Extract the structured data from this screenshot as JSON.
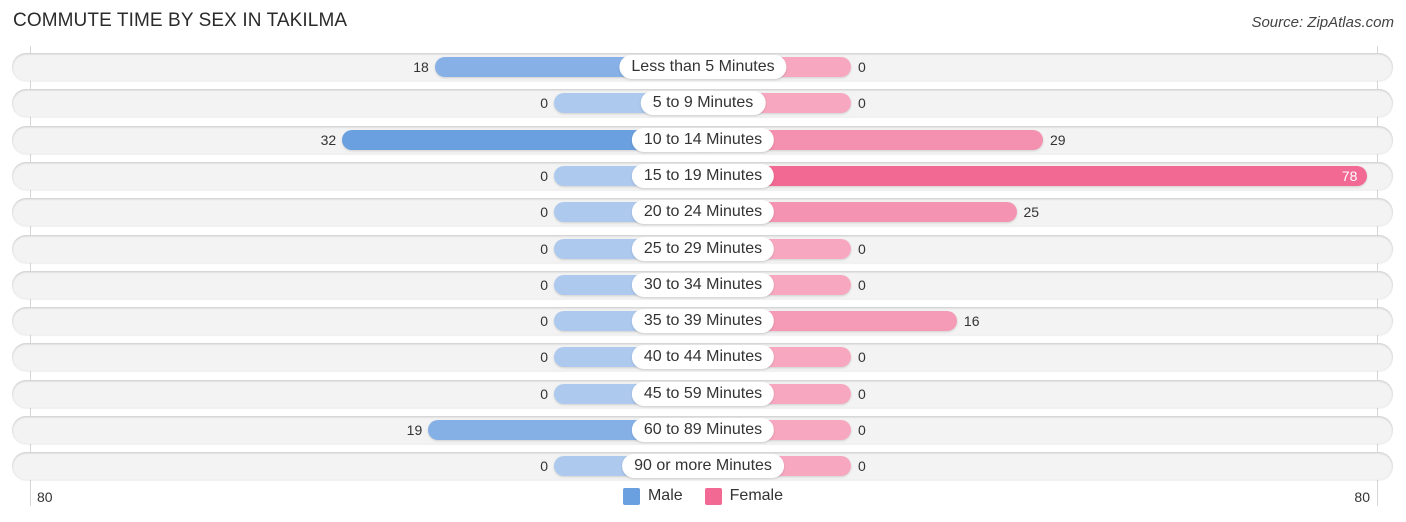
{
  "header": {
    "title": "COMMUTE TIME BY SEX IN TAKILMA",
    "source": "Source: ZipAtlas.com"
  },
  "colors": {
    "male": "#6a9fe0",
    "male_light": "#adc9ee",
    "female": "#f26a94",
    "female_light": "#f7a8c0",
    "row_bg": "#f3f3f3"
  },
  "chart_data": {
    "type": "bar",
    "orientation": "horizontal-diverging",
    "title": "COMMUTE TIME BY SEX IN TAKILMA",
    "categories": [
      "Less than 5 Minutes",
      "5 to 9 Minutes",
      "10 to 14 Minutes",
      "15 to 19 Minutes",
      "20 to 24 Minutes",
      "25 to 29 Minutes",
      "30 to 34 Minutes",
      "35 to 39 Minutes",
      "40 to 44 Minutes",
      "45 to 59 Minutes",
      "60 to 89 Minutes",
      "90 or more Minutes"
    ],
    "series": [
      {
        "name": "Male",
        "values": [
          18,
          0,
          32,
          0,
          0,
          0,
          0,
          0,
          0,
          0,
          19,
          0
        ]
      },
      {
        "name": "Female",
        "values": [
          0,
          0,
          29,
          78,
          25,
          0,
          0,
          16,
          0,
          0,
          0,
          0
        ]
      }
    ],
    "axis": {
      "left_label": "80",
      "right_label": "80",
      "max": 80
    },
    "legend": {
      "placement": "bottom-center",
      "entries": [
        "Male",
        "Female"
      ]
    }
  }
}
